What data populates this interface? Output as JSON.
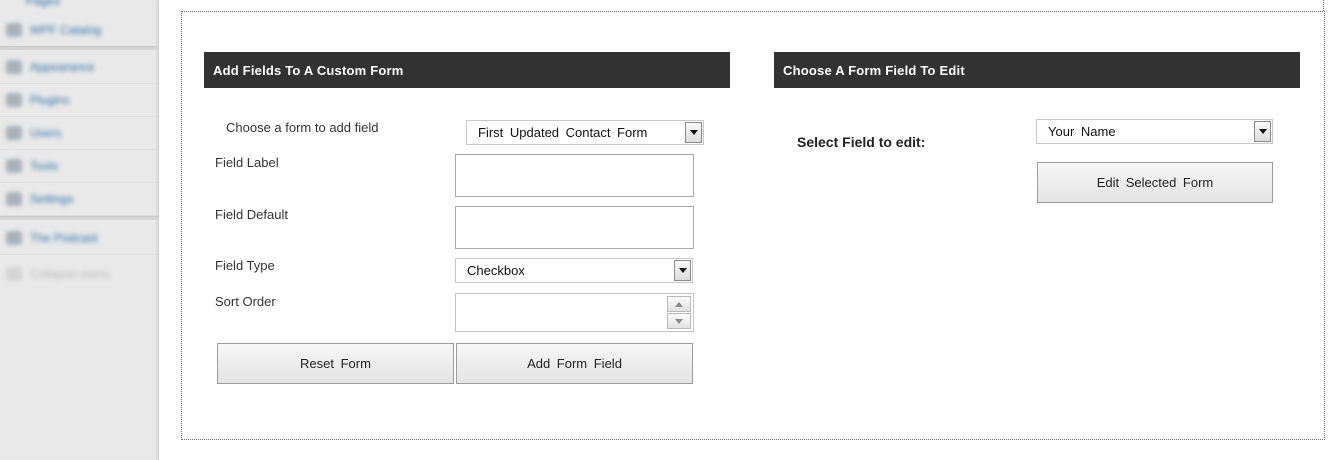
{
  "sidebar": {
    "top_partial": "Pages",
    "items": [
      {
        "label": "WPF Catalog",
        "icon": "catalog-icon"
      },
      {
        "label": "Appearance",
        "icon": "appearance-icon"
      },
      {
        "label": "Plugins",
        "icon": "plugins-icon"
      },
      {
        "label": "Users",
        "icon": "users-icon"
      },
      {
        "label": "Tools",
        "icon": "tools-icon"
      },
      {
        "label": "Settings",
        "icon": "settings-icon"
      },
      {
        "label": "The Podcast",
        "icon": "podcast-icon"
      },
      {
        "label": "Collapse menu",
        "icon": "collapse-icon"
      }
    ]
  },
  "add_panel": {
    "title": "Add Fields To A Custom Form",
    "choose_form_label": "Choose a form to add field",
    "choose_form_value": "First Updated Contact Form",
    "field_label_label": "Field Label",
    "field_label_value": "",
    "field_default_label": "Field Default",
    "field_default_value": "",
    "field_type_label": "Field Type",
    "field_type_value": "Checkbox",
    "sort_order_label": "Sort Order",
    "sort_order_value": "",
    "reset_button": "Reset Form",
    "add_button": "Add Form Field"
  },
  "edit_panel": {
    "title": "Choose A Form Field To Edit",
    "select_label": "Select Field to edit:",
    "select_value": "Your Name",
    "edit_button": "Edit Selected Form"
  }
}
